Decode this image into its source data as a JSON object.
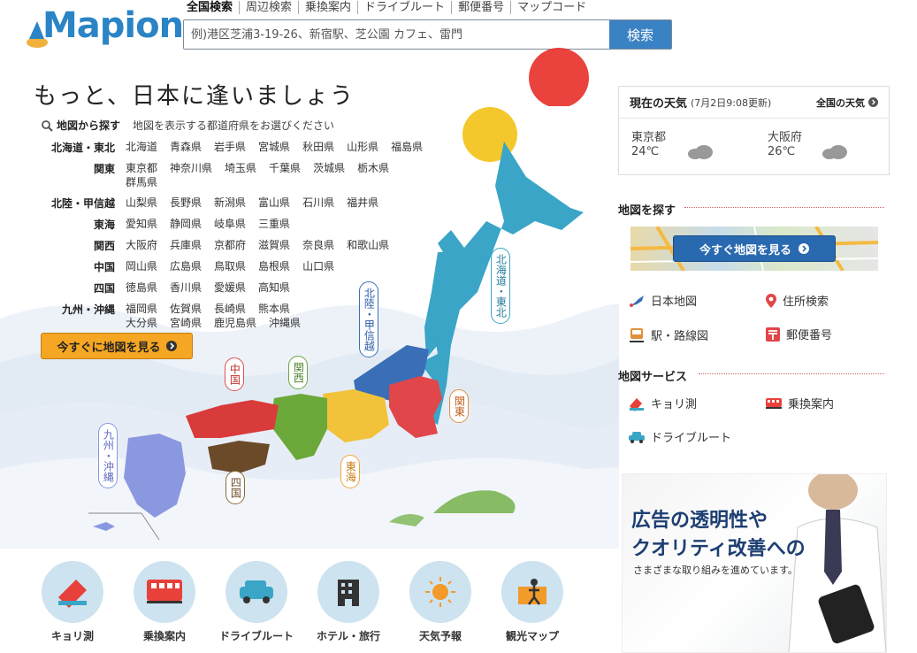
{
  "header": {
    "logo_text": "Mapion",
    "search_tabs": [
      "全国検索",
      "周辺検索",
      "乗換案内",
      "ドライブルート",
      "郵便番号",
      "マップコード"
    ],
    "search_placeholder": "例)港区芝浦3-19-26、新宿駅、芝公園 カフェ、雷門",
    "search_button": "検索"
  },
  "main": {
    "tagline": "もっと、日本に逢いましょう",
    "find_label": "地図から探す",
    "find_desc": "地図を表示する都道府県をお選びください",
    "regions": [
      {
        "name": "北海道・東北",
        "prefs": [
          "北海道",
          "青森県",
          "岩手県",
          "宮城県",
          "秋田県",
          "山形県",
          "福島県"
        ]
      },
      {
        "name": "関東",
        "prefs": [
          "東京都",
          "神奈川県",
          "埼玉県",
          "千葉県",
          "茨城県",
          "栃木県",
          "群馬県"
        ]
      },
      {
        "name": "北陸・甲信越",
        "prefs": [
          "山梨県",
          "長野県",
          "新潟県",
          "富山県",
          "石川県",
          "福井県"
        ]
      },
      {
        "name": "東海",
        "prefs": [
          "愛知県",
          "静岡県",
          "岐阜県",
          "三重県"
        ]
      },
      {
        "name": "関西",
        "prefs": [
          "大阪府",
          "兵庫県",
          "京都府",
          "滋賀県",
          "奈良県",
          "和歌山県"
        ]
      },
      {
        "name": "中国",
        "prefs": [
          "岡山県",
          "広島県",
          "鳥取県",
          "島根県",
          "山口県"
        ]
      },
      {
        "name": "四国",
        "prefs": [
          "徳島県",
          "香川県",
          "愛媛県",
          "高知県"
        ]
      },
      {
        "name": "九州・沖縄",
        "prefs": [
          "福岡県",
          "佐賀県",
          "長崎県",
          "熊本県",
          "大分県",
          "宮崎県",
          "鹿児島県",
          "沖縄県"
        ]
      }
    ],
    "map_button": "今すぐに地図を見る",
    "map_tags": {
      "hokkaido_tohoku": "北海道・東北",
      "hokuriku": "北陸・甲信越",
      "kanto": "関東",
      "chugoku": "中国",
      "kansai": "関西",
      "tokai": "東海",
      "shikoku": "四国",
      "kyushu": "九州・沖縄"
    },
    "region_colors": {
      "hokkaido_tohoku": "#3aa5c6",
      "hokuriku": "#3a6fb8",
      "kanto": "#e0464a",
      "chugoku": "#d93a3a",
      "kansai": "#6ba83a",
      "tokai": "#f2c23a",
      "shikoku": "#6b4a2a",
      "kyushu": "#8a98e0"
    }
  },
  "services": [
    {
      "label": "キョリ測",
      "icon": "ruler-icon"
    },
    {
      "label": "乗換案内",
      "icon": "train-icon"
    },
    {
      "label": "ドライブルート",
      "icon": "car-icon"
    },
    {
      "label": "ホテル・旅行",
      "icon": "hotel-icon"
    },
    {
      "label": "天気予報",
      "icon": "sun-icon"
    },
    {
      "label": "観光マップ",
      "icon": "sightseeing-icon"
    }
  ],
  "weather": {
    "title": "現在の天気",
    "updated": "(7月2日9:08更新)",
    "all_link": "全国の天気",
    "cities": [
      {
        "name": "東京都",
        "temp": "24℃"
      },
      {
        "name": "大阪府",
        "temp": "26℃"
      }
    ]
  },
  "sidebar": {
    "find_map_title": "地図を探す",
    "map_banner_button": "今すぐ地図を見る",
    "links": [
      {
        "label": "日本地図",
        "icon": "japan-map-icon"
      },
      {
        "label": "住所検索",
        "icon": "pin-icon"
      },
      {
        "label": "駅・路線図",
        "icon": "station-icon"
      },
      {
        "label": "郵便番号",
        "icon": "postal-icon"
      }
    ],
    "services_title": "地図サービス",
    "service_links": [
      {
        "label": "キョリ測",
        "icon": "ruler-icon"
      },
      {
        "label": "乗換案内",
        "icon": "train-icon"
      },
      {
        "label": "ドライブルート",
        "icon": "car-icon"
      }
    ]
  },
  "ad": {
    "line1": "広告の透明性や",
    "line2": "クオリティ改善への",
    "line3": "さまざまな取り組みを進めています。"
  }
}
